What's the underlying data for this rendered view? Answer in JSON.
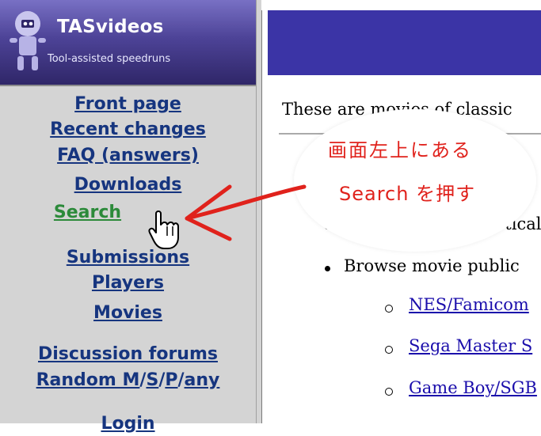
{
  "site": {
    "name": "TASvideos",
    "tagline": "Tool-assisted speedruns"
  },
  "sidebar": {
    "links": [
      {
        "label": "Front page"
      },
      {
        "label": "Recent changes"
      },
      {
        "label": "FAQ (answers)"
      },
      {
        "label": "Downloads"
      },
      {
        "label": "Search"
      },
      {
        "label": "Submissions"
      },
      {
        "label": "Players"
      },
      {
        "label": "Movies"
      },
      {
        "label": "Discussion forums"
      }
    ],
    "random": {
      "prefix": "Random M",
      "sep1": "/",
      "s": "S",
      "sep2": "/",
      "p": "P",
      "sep3": "/",
      "any": "any"
    },
    "login": "Login"
  },
  "main": {
    "intro": "These are movies of classic",
    "bullets": [
      "Browse an alphabetical l",
      "Browse movie public"
    ],
    "sublinks": [
      "NES/Famicom",
      "Sega Master S",
      "Game Boy/SGB"
    ]
  },
  "annotation": {
    "line1": "画面左上にある",
    "line2": "Search を押す",
    "color": "#e0221c"
  },
  "colors": {
    "link": "#16357f",
    "active_link": "#2c8a3a",
    "header": "#3b34a6"
  }
}
